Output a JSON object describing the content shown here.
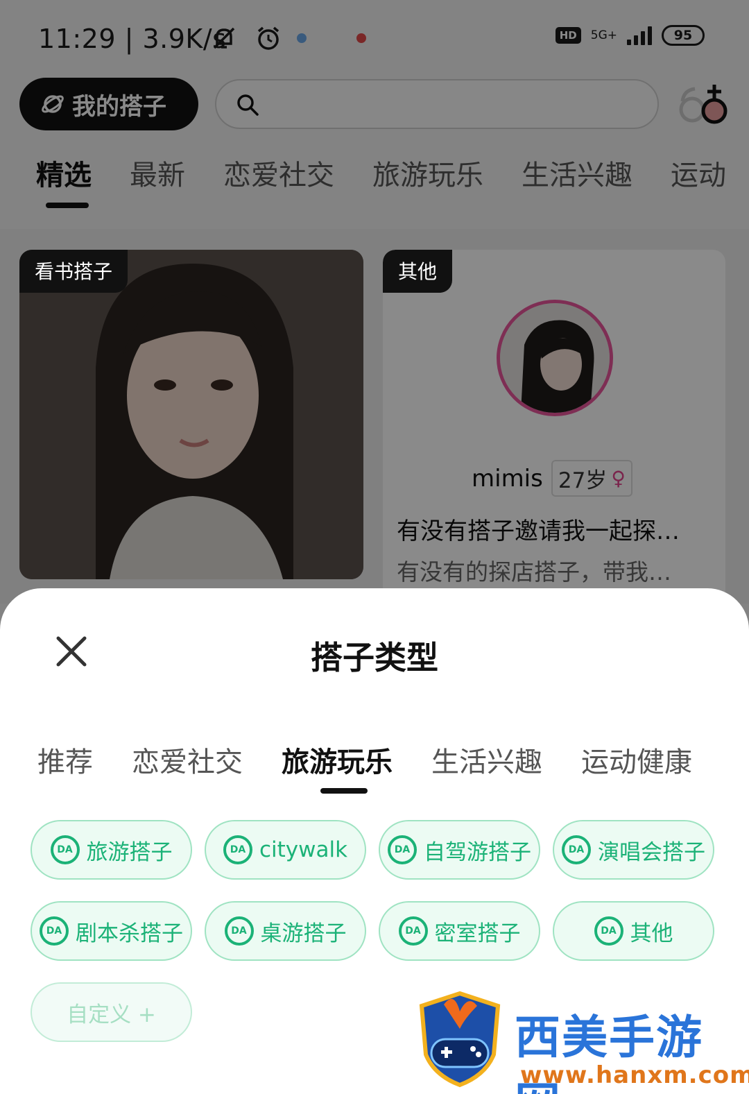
{
  "status_bar": {
    "time": "11:29 | 3.9K/s",
    "hd": "HD",
    "network": "5G+",
    "battery": "95"
  },
  "top_bar": {
    "my_partner_label": "我的搭子",
    "search_placeholder": ""
  },
  "main_tabs": [
    "精选",
    "最新",
    "恋爱社交",
    "旅游玩乐",
    "生活兴趣",
    "运动"
  ],
  "feed": {
    "card1": {
      "tag": "看书搭子"
    },
    "card2": {
      "tag": "其他",
      "user_name": "mimis",
      "age": "27岁",
      "gender_symbol": "♀",
      "title": "有没有搭子邀请我一起探…",
      "body": "有没有的探店搭子，带我…"
    }
  },
  "sheet": {
    "title": "搭子类型",
    "tabs": [
      "推荐",
      "恋爱社交",
      "旅游玩乐",
      "生活兴趣",
      "运动健康"
    ],
    "active_tab": "旅游玩乐",
    "chips": [
      {
        "label": "旅游搭子"
      },
      {
        "label": "citywalk"
      },
      {
        "label": "自驾游搭子"
      },
      {
        "label": "演唱会搭子"
      },
      {
        "label": "剧本杀搭子"
      },
      {
        "label": "桌游搭子"
      },
      {
        "label": "密室搭子"
      },
      {
        "label": "其他"
      }
    ],
    "custom_chip": "自定义 +",
    "chip_icon_text": "DA"
  },
  "watermark": {
    "name": "西美手游网",
    "url": "www.hanxm.com"
  },
  "colors": {
    "accent_green": "#1bb277",
    "chip_bg": "#ecfbf3",
    "female_pink": "#e2448d"
  }
}
